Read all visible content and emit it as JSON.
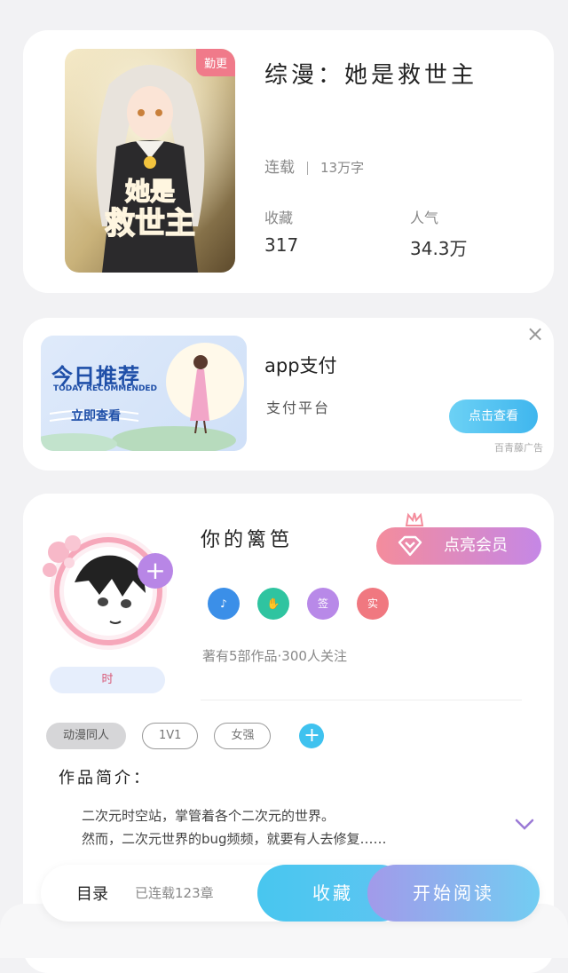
{
  "book": {
    "title": "综漫：她是救世主",
    "cover_tag": "勤更",
    "cover_title": "她是救世主",
    "status": "连载",
    "word_count": "13万字",
    "favorites_label": "收藏",
    "favorites_value": "317",
    "popularity_label": "人气",
    "popularity_value": "34.3万"
  },
  "ad": {
    "banner_title": "今日推荐",
    "banner_subtitle": "TODAY RECOMMENDED",
    "banner_cta": "立即查看",
    "title": "app支付",
    "subtitle": "支付平台",
    "button": "点击查看",
    "note": "百青藤广告",
    "close_icon": "close-icon"
  },
  "author": {
    "name": "你的篱笆",
    "vip_button": "点亮会员",
    "badge_text": "时",
    "stats": "著有5部作品·300人关注",
    "medals": [
      {
        "icon": "music-note-icon",
        "color": "#3b8fe8",
        "text": "♪"
      },
      {
        "icon": "handshake-icon",
        "color": "#2fc4a0",
        "text": "✋"
      },
      {
        "icon": "sign-icon",
        "color": "#b889e8",
        "text": "签"
      },
      {
        "icon": "real-icon",
        "color": "#f07880",
        "text": "实"
      }
    ],
    "tags": [
      "动漫同人",
      "1V1",
      "女强"
    ],
    "intro_title": "作品简介：",
    "intro_lines": [
      "二次元时空站，掌管着各个二次元的世界。",
      "然而，二次元世界的bug频频，就要有人去修复……"
    ]
  },
  "bottom": {
    "toc_label": "目录",
    "toc_count": "已连载123章",
    "collect": "收藏",
    "read": "开始阅读"
  }
}
